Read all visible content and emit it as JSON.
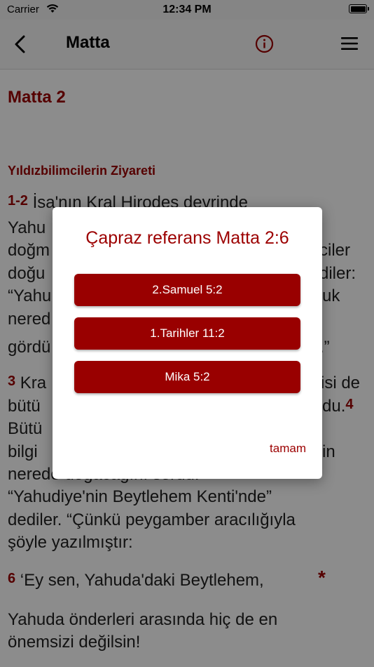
{
  "status_bar": {
    "carrier": "Carrier",
    "time": "12:34 PM"
  },
  "navbar": {
    "title": "Matta",
    "icons": [
      "back-chevron-icon",
      "info-icon",
      "hamburger-menu-icon"
    ]
  },
  "reading": {
    "chapter_title": "Matta 2",
    "section_heading": "Yıldızbilimcilerin Ziyareti",
    "verse_1_2_num": "1-2",
    "verse_1_2_line1": "İsa'nın Kral Hirodes devrinde",
    "line_2": "Yahu",
    "line_2r": "",
    "line_3": "doğm",
    "line_3r": "ciler",
    "line_4": "doğu",
    "line_4r": "diler:",
    "line_5": "“Yahu",
    "line_5r": "uk",
    "line_6": "nered",
    "line_7": "gördü",
    "line_7r": ".”",
    "verse_3_num": "3",
    "line_8": "Kra",
    "line_8r": "isi de",
    "line_9": "bütü",
    "line_9r": "du.",
    "verse_4_num": "4",
    "line_10": "Bütü",
    "line_11": "bilgi",
    "line_11r": "in",
    "line_12": "nerede doğacağını sordu.",
    "line_13": "“Yahudiye'nin Beytlehem Kenti'nde”",
    "line_14": "dediler. “Çünkü peygamber aracılığıyla",
    "line_15": "şöyle yazılmıştır:",
    "verse_6_num": "6",
    "line_16": "‘Ey sen, Yahuda'daki Beytlehem,",
    "footnote_marker": "*",
    "line_17": "Yahuda önderleri arasında hiç de en",
    "line_18": "önemsizi değilsin!"
  },
  "dialog": {
    "title": "Çapraz referans Matta 2:6",
    "refs": [
      "2.Samuel 5:2",
      "1.Tarihler 11:2",
      "Mika 5:2"
    ],
    "ok_label": "tamam"
  },
  "colors": {
    "accent": "#9c0000",
    "button": "#990000"
  }
}
